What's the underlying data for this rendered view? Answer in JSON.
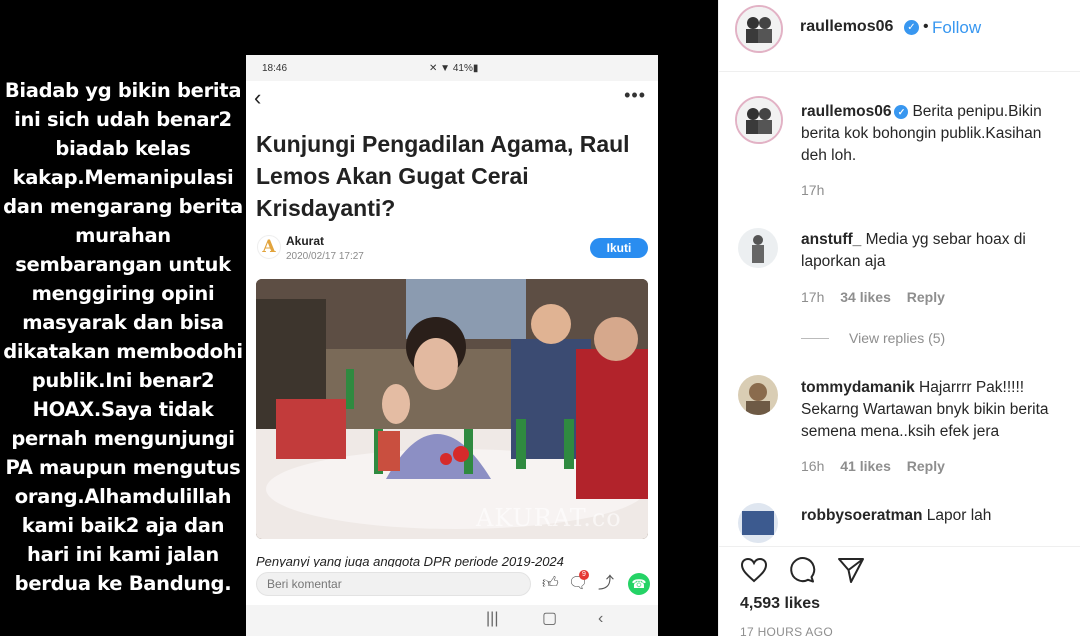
{
  "post_image": {
    "side_text": "Biadab yg bikin berita ini sich udah benar2 biadab kelas kakap.Memanipulasi dan mengarang berita murahan sembarangan untuk menggiring opini masyarak dan bisa dikatakan membodohi publik.Ini benar2 HOAX.Saya tidak pernah mengunjungi PA maupun mengutus orang.Alhamdulillah kami baik2 aja dan hari ini kami jalan berdua ke Bandung.",
    "phone": {
      "time": "18:46",
      "status_icons": "✕ ▼ 41%▮",
      "back_icon": "‹",
      "more_icon": "•••",
      "article_title": "Kunjungi Pengadilan Agama, Raul Lemos Akan Gugat Cerai Krisdayanti?",
      "source_logo": "A",
      "source_name": "Akurat",
      "source_date": "2020/02/17 17:27",
      "follow_label": "Ikuti",
      "photo_watermark": "AKURAT.co",
      "caption": "Penyanyi yang juga anggota DPR periode 2019-2024",
      "comment_placeholder": "Beri komentar",
      "badge_count": "9",
      "icons": [
        "like-icon",
        "comment-icon",
        "share-icon",
        "whatsapp-icon"
      ],
      "nav_keys": [
        "|||",
        "▢",
        "‹"
      ]
    }
  },
  "panel": {
    "header": {
      "username": "raullemos06",
      "separator": "•",
      "follow_label": "Follow"
    },
    "caption": {
      "username": "raullemos06",
      "text": "Berita penipu.Bikin berita kok bohongin publik.Kasihan deh loh.",
      "time": "17h"
    },
    "comments": [
      {
        "username": "anstuff_",
        "text": "Media yg sebar hoax di laporkan aja",
        "time": "17h",
        "likes": "34 likes",
        "reply": "Reply"
      },
      {
        "username": "tommydamanik",
        "text": "Hajarrrr Pak!!!!! Sekarng Wartawan bnyk bikin berita semena mena..ksih efek jera",
        "time": "16h",
        "likes": "41 likes",
        "reply": "Reply"
      },
      {
        "username": "robbysoeratman",
        "text": "Lapor lah",
        "time": "",
        "likes": "",
        "reply": ""
      }
    ],
    "view_replies": "View replies (5)",
    "likes": "4,593 likes",
    "post_time": "17 HOURS AGO"
  },
  "colors": {
    "accent": "#3897f0",
    "follow_button": "#2a8df0",
    "whatsapp": "#25d366",
    "text_primary": "#262626",
    "text_secondary": "#8e8e8e"
  }
}
